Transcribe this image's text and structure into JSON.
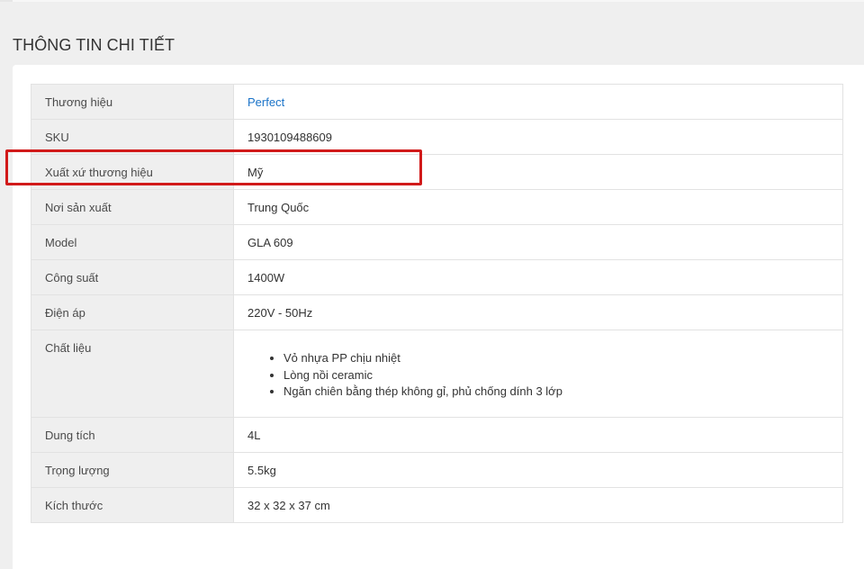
{
  "section": {
    "title": "THÔNG TIN CHI TIẾT"
  },
  "specs": {
    "rows": [
      {
        "label": "Thương hiệu",
        "value": "Perfect"
      },
      {
        "label": "SKU",
        "value": "1930109488609"
      },
      {
        "label": "Xuất xứ thương hiệu",
        "value": "Mỹ"
      },
      {
        "label": "Nơi sản xuất",
        "value": "Trung Quốc"
      },
      {
        "label": "Model",
        "value": "GLA 609"
      },
      {
        "label": "Công suất",
        "value": "1400W"
      },
      {
        "label": "Điện áp",
        "value": "220V - 50Hz"
      },
      {
        "label": "Chất liệu",
        "items": [
          "Vỏ nhựa PP chịu nhiệt",
          "Lòng nồi ceramic",
          "Ngăn chiên bằng thép không gỉ, phủ chống dính 3 lớp"
        ]
      },
      {
        "label": "Dung tích",
        "value": "4L"
      },
      {
        "label": "Trọng lượng",
        "value": "5.5kg"
      },
      {
        "label": "Kích thước",
        "value": "32 x 32 x 37 cm"
      }
    ]
  },
  "colors": {
    "link": "#1a73c8",
    "highlight": "#d11a1a",
    "label_bg": "#efefef",
    "page_bg": "#efefef"
  }
}
